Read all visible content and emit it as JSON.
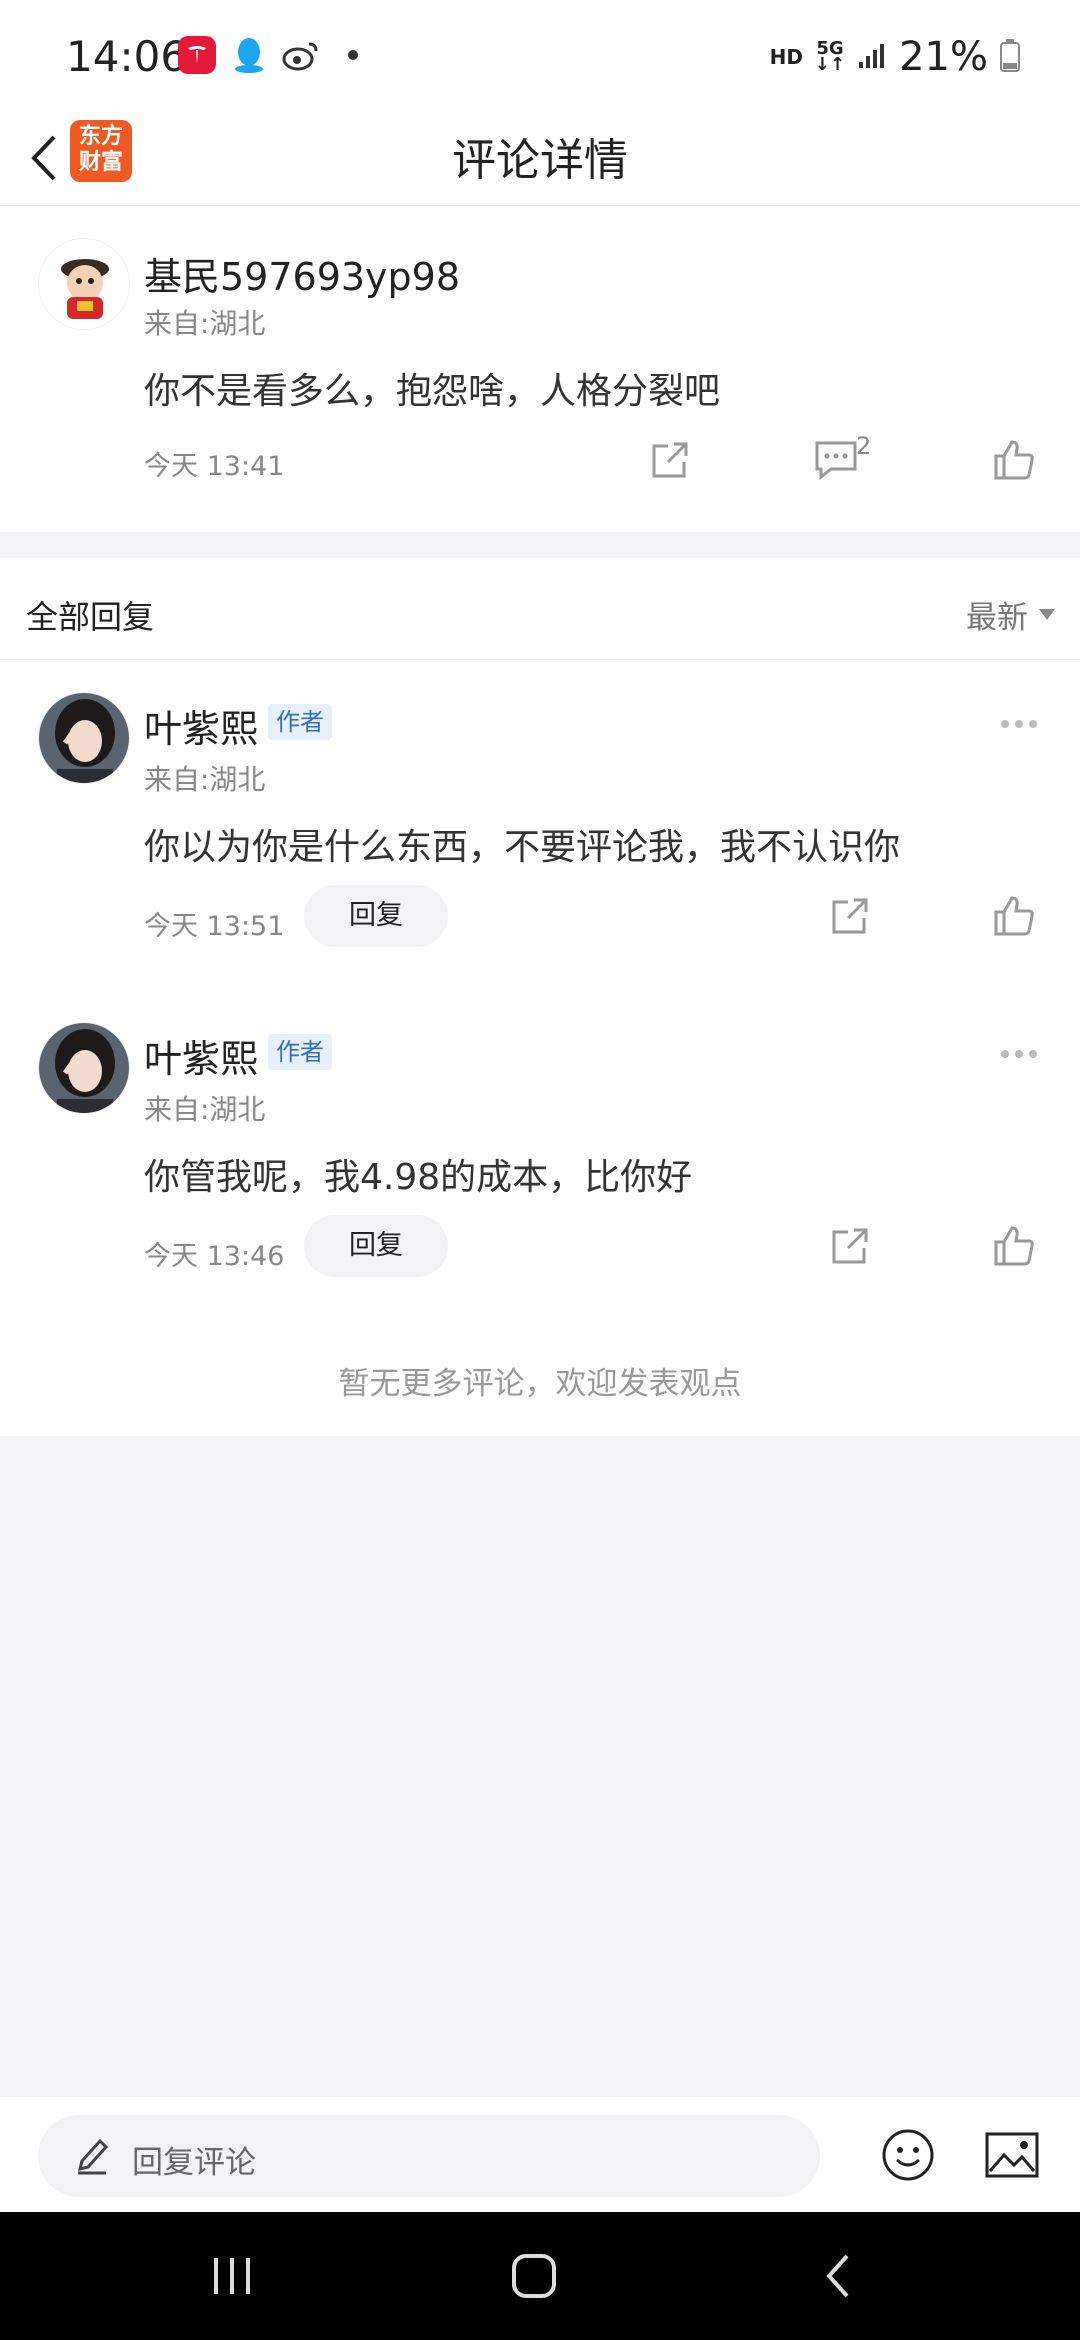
{
  "status_bar": {
    "time": "14:06",
    "hd": "HD",
    "network": "5G",
    "battery": "21%"
  },
  "header": {
    "logo_line1": "东方",
    "logo_line2": "财富",
    "title": "评论详情"
  },
  "main_comment": {
    "username": "基民597693yp98",
    "location": "来自:湖北",
    "content": "你不是看多么，抱怨啥，人格分裂吧",
    "time": "今天 13:41",
    "reply_count": "2"
  },
  "replies_section": {
    "header": "全部回复",
    "sort_label": "最新",
    "replies": [
      {
        "username": "叶紫熙",
        "tag": "作者",
        "location": "来自:湖北",
        "content": "你以为你是什么东西，不要评论我，我不认识你",
        "time": "今天 13:51",
        "reply_label": "回复"
      },
      {
        "username": "叶紫熙",
        "tag": "作者",
        "location": "来自:湖北",
        "content": "你管我呢，我4.98的成本，比你好",
        "time": "今天 13:46",
        "reply_label": "回复"
      }
    ],
    "end_text": "暂无更多评论，欢迎发表观点"
  },
  "bottom_bar": {
    "placeholder": "回复评论"
  },
  "colors": {
    "brand": "#f05a22",
    "tag_bg": "#e7f0fb",
    "tag_text": "#2f6fbf"
  }
}
